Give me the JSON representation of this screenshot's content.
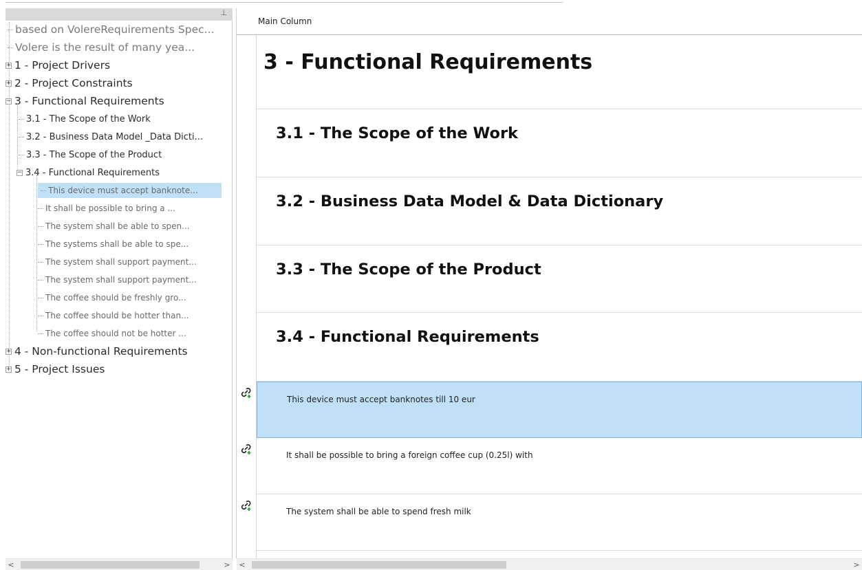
{
  "tree": {
    "pin_glyph": "⊥",
    "items": [
      {
        "label": "based on VolereRequirements Spec...",
        "level": 0,
        "expander": "none",
        "gray": true
      },
      {
        "label": "Volere is the result of many yea...",
        "level": 0,
        "expander": "none",
        "gray": true
      },
      {
        "label": "1 - Project Drivers",
        "level": 0,
        "expander": "+"
      },
      {
        "label": "2 - Project Constraints",
        "level": 0,
        "expander": "+"
      },
      {
        "label": "3 - Functional Requirements",
        "level": 0,
        "expander": "-"
      },
      {
        "label": "3.1 - The Scope of the Work",
        "level": 1,
        "expander": "none"
      },
      {
        "label": "3.2 - Business Data Model _Data Dicti...",
        "level": 1,
        "expander": "none"
      },
      {
        "label": "3.3 - The Scope of the Product",
        "level": 1,
        "expander": "none"
      },
      {
        "label": "3.4 - Functional Requirements",
        "level": 1,
        "expander": "-"
      },
      {
        "label": "This device must accept banknote...",
        "level": 2,
        "expander": "none",
        "selected": true
      },
      {
        "label": "It shall be possible to bring a ...",
        "level": 2,
        "expander": "none"
      },
      {
        "label": "The system shall be able to spen...",
        "level": 2,
        "expander": "none"
      },
      {
        "label": "The systems shall be able to spe...",
        "level": 2,
        "expander": "none"
      },
      {
        "label": "The system shall support payment...",
        "level": 2,
        "expander": "none"
      },
      {
        "label": "The system shall support payment...",
        "level": 2,
        "expander": "none"
      },
      {
        "label": "The coffee should be freshly gro...",
        "level": 2,
        "expander": "none"
      },
      {
        "label": "The coffee should be hotter than...",
        "level": 2,
        "expander": "none"
      },
      {
        "label": "The coffee should not be hotter ...",
        "level": 2,
        "expander": "none"
      },
      {
        "label": "4 - Non-functional Requirements",
        "level": 0,
        "expander": "+"
      },
      {
        "label": "5 - Project Issues",
        "level": 0,
        "expander": "+"
      }
    ]
  },
  "main": {
    "column_title": "Main Column",
    "rows": [
      {
        "text": "3 - Functional Requirements",
        "kind": "h0"
      },
      {
        "text": "3.1 - The Scope of the Work",
        "kind": "h1"
      },
      {
        "text": "3.2 - Business Data Model & Data Dictionary",
        "kind": "h1"
      },
      {
        "text": "3.3 - The Scope of the Product",
        "kind": "h1"
      },
      {
        "text": "3.4 - Functional Requirements",
        "kind": "h1"
      },
      {
        "text": "This device must accept banknotes till 10 eur",
        "kind": "req",
        "selected": true,
        "link_icon": "link-icon"
      },
      {
        "text": "It shall be possible to bring a foreign coffee cup (0.25l) with",
        "kind": "req",
        "link_icon": "link-icon"
      },
      {
        "text": "The system shall be able to spend fresh milk",
        "kind": "req",
        "link_icon": "link-icon"
      }
    ]
  },
  "scrollbars": {
    "left_arrow": "<",
    "right_arrow": ">"
  },
  "colors": {
    "selection": "#bfe0f7",
    "selection_border": "#7fb4e0",
    "link_icon_green": "#2e9e3a"
  }
}
